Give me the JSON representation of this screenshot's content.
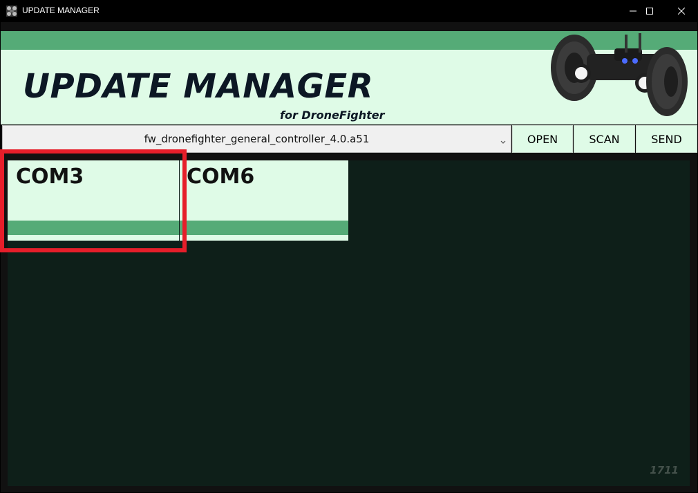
{
  "window": {
    "title": "UPDATE MANAGER",
    "icons": {
      "app": "drone-app-icon",
      "minimize": "minimize-icon",
      "maximize": "maximize-icon",
      "close": "close-icon"
    }
  },
  "header": {
    "title": "UPDATE MANAGER",
    "subtitle": "for DroneFighter",
    "image": "drone-robot-image"
  },
  "toolbar": {
    "firmware_selected": "fw_dronefighter_general_controller_4.0.a51",
    "open_label": "OPEN",
    "scan_label": "SCAN",
    "send_label": "SEND"
  },
  "ports": [
    {
      "name": "COM3",
      "selected": true
    },
    {
      "name": "COM6",
      "selected": false
    }
  ],
  "footer": {
    "watermark": "1711"
  },
  "colors": {
    "accent_green": "#55ab77",
    "panel_mint": "#dffbe7",
    "content_bg": "#0e1f19",
    "highlight_red": "#e61e2a",
    "title_text": "#0c1724"
  }
}
